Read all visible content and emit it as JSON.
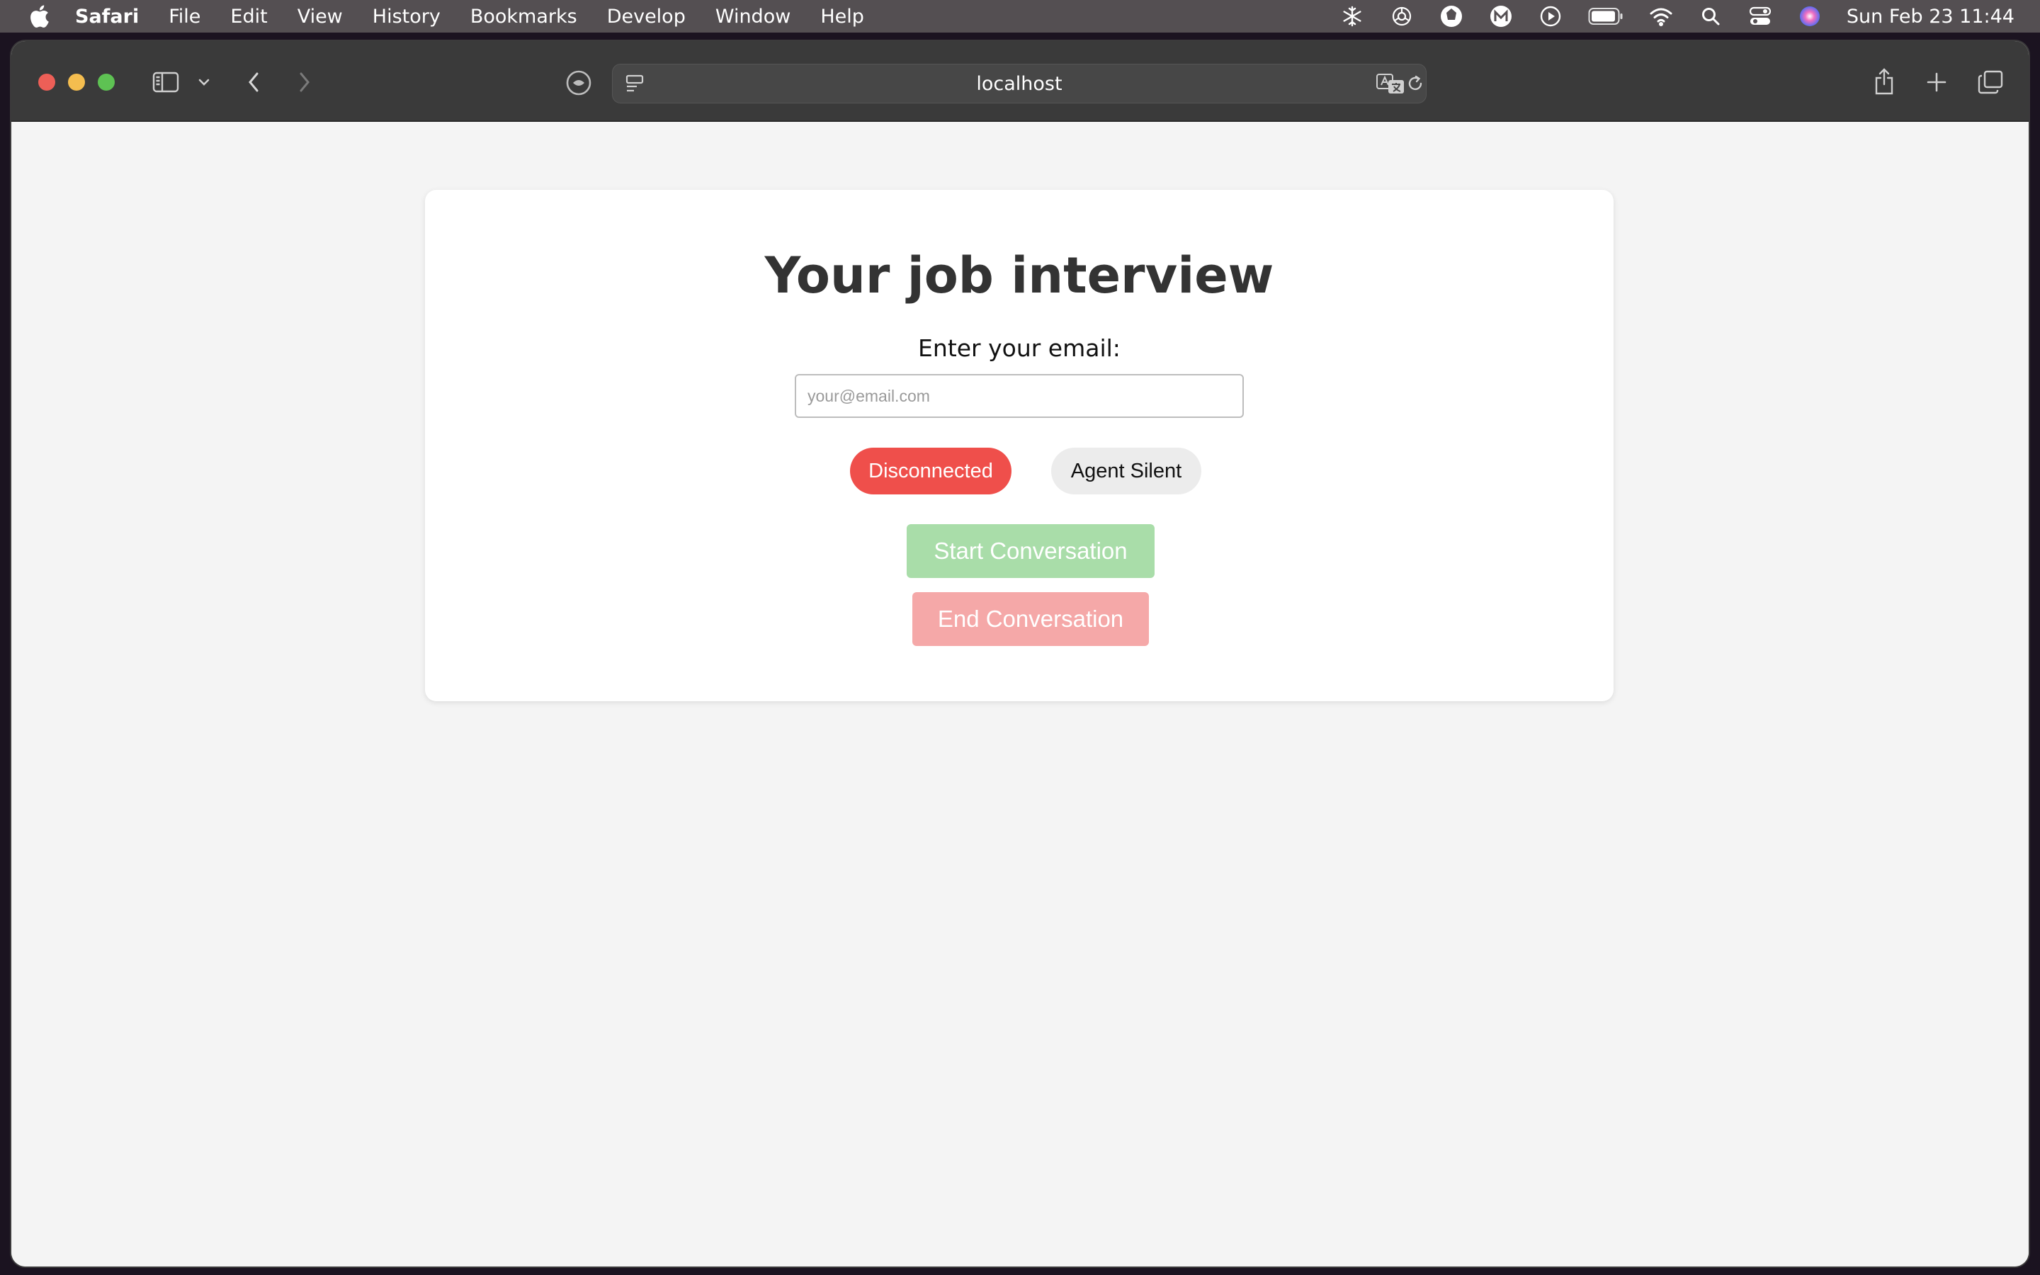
{
  "menubar": {
    "app_name": "Safari",
    "items": [
      "File",
      "Edit",
      "View",
      "History",
      "Bookmarks",
      "Develop",
      "Window",
      "Help"
    ],
    "clock": "Sun Feb 23  11:44",
    "status_icons": [
      "snowflake-icon",
      "openai-icon",
      "aperture-icon",
      "m-app-icon",
      "play-icon",
      "battery-icon",
      "wifi-icon",
      "spotlight-search-icon",
      "control-center-icon",
      "siri-icon"
    ]
  },
  "browser": {
    "url": "localhost",
    "icons": [
      "sidebar-icon",
      "chevron-down-icon",
      "back-icon",
      "forward-icon",
      "privacy-shield-icon",
      "reader-icon",
      "translate-icon",
      "reload-icon",
      "share-icon",
      "new-tab-icon",
      "tab-overview-icon"
    ]
  },
  "page": {
    "title": "Your job interview",
    "email_label": "Enter your email:",
    "email_placeholder": "your@email.com",
    "email_value": "",
    "status": {
      "connection": "Disconnected",
      "agent": "Agent Silent"
    },
    "buttons": {
      "start": "Start Conversation",
      "end": "End Conversation"
    }
  },
  "colors": {
    "disconnected": "#ef4f4b",
    "start_button": "#a9dda9",
    "end_button": "#f5a8a8",
    "title": "#333333"
  }
}
